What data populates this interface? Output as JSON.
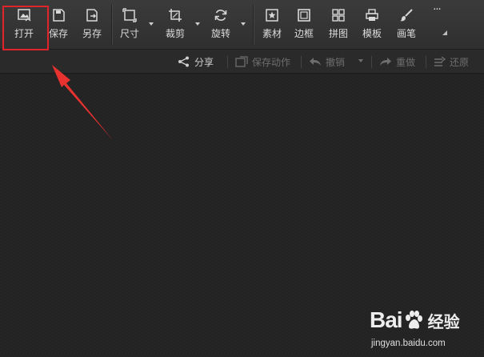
{
  "toolbar": {
    "open_label": "打开",
    "save_label": "保存",
    "save_as_label": "另存",
    "size_label": "尺寸",
    "crop_label": "裁剪",
    "rotate_label": "旋转",
    "material_label": "素材",
    "border_label": "边框",
    "collage_label": "拼图",
    "template_label": "模板",
    "brush_label": "画笔",
    "more_label": "···"
  },
  "subbar": {
    "share_label": "分享",
    "save_action_label": "保存动作",
    "undo_label": "撤销",
    "redo_label": "重做",
    "restore_label": "还原"
  },
  "annotation": {
    "highlight_color": "#e0242a",
    "arrow_color": "#e8322f"
  },
  "watermark": {
    "brand_left": "Bai",
    "brand_right": "经验",
    "url": "jingyan.baidu.com"
  }
}
